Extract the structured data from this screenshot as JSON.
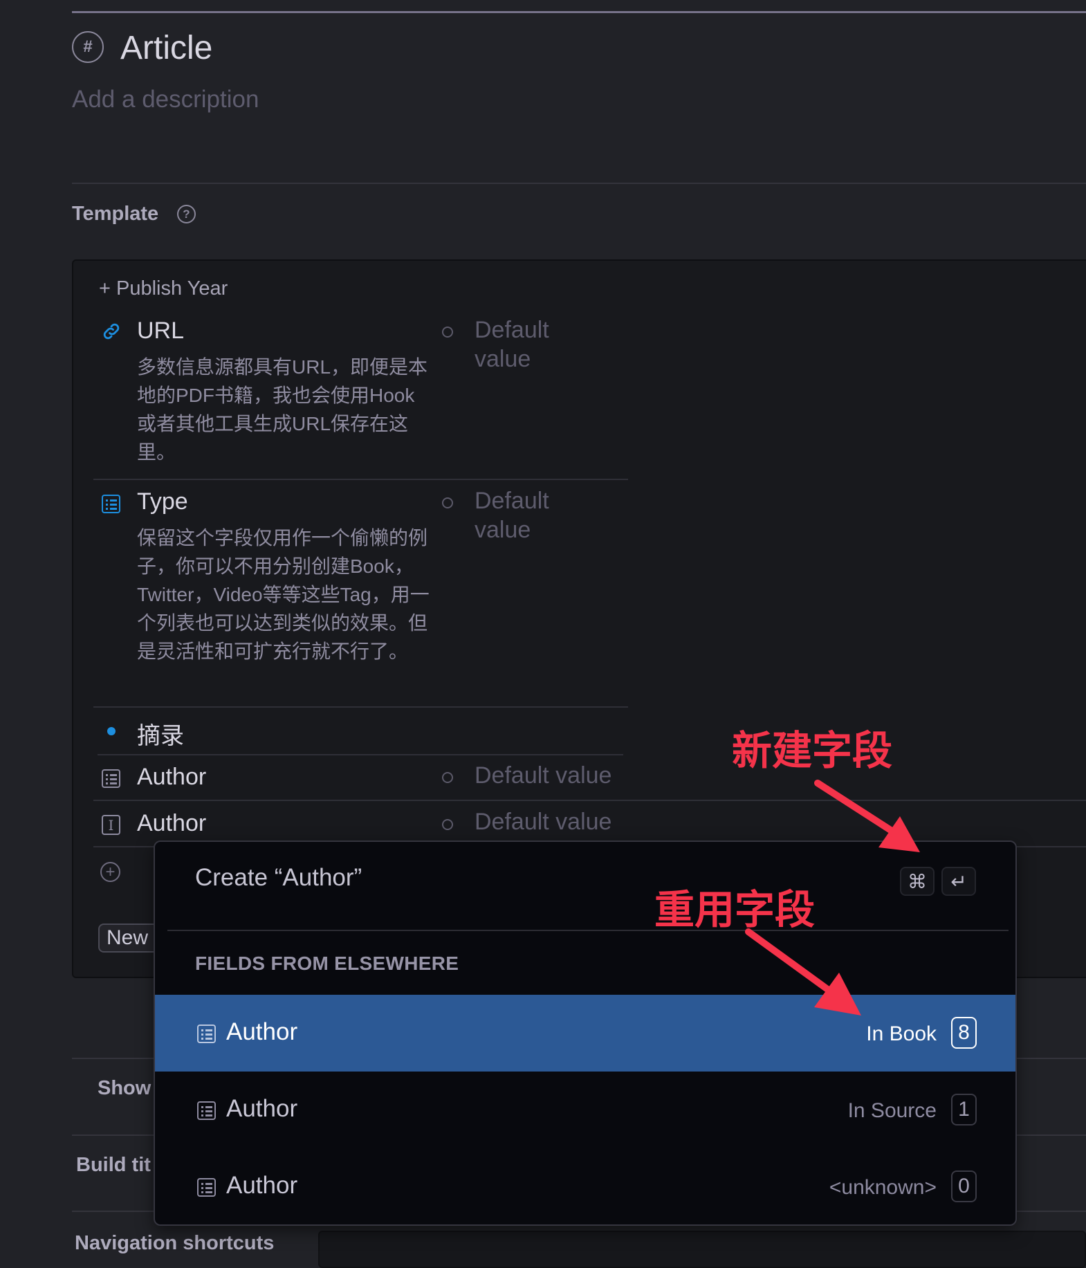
{
  "header": {
    "tag_icon": "hash-icon",
    "title": "Article",
    "description_placeholder": "Add a description"
  },
  "template": {
    "label": "Template",
    "help_icon": "question-circle-icon",
    "publish_year": {
      "icon": "plus-icon",
      "label": "Publish Year"
    },
    "fields": [
      {
        "icon": "link-icon",
        "name": "URL",
        "description": "多数信息源都具有URL，即便是本地的PDF书籍，我也会使用Hook或者其他工具生成URL保存在这里。",
        "default_placeholder": "Default value"
      },
      {
        "icon": "list-icon",
        "name": "Type",
        "description": "保留这个字段仅用作一个偷懒的例子，你可以不用分别创建Book，Twitter，Video等等这些Tag，用一个列表也可以达到类似的效果。但是灵活性和可扩充行就不行了。",
        "default_placeholder": "Default value"
      },
      {
        "icon": "dot-icon",
        "name": "摘录"
      },
      {
        "icon": "list-icon",
        "name": "Author",
        "default_placeholder": "Default value"
      },
      {
        "icon": "text-icon",
        "name": "Author",
        "default_placeholder": "Default value"
      }
    ],
    "add_field_icon": "plus-circle-icon",
    "new_button": "New"
  },
  "popup": {
    "create_label": "Create “Author”",
    "shortcut_keys": [
      "⌘",
      "↵"
    ],
    "section_label": "FIELDS FROM ELSEWHERE",
    "items": [
      {
        "icon": "list-icon",
        "name": "Author",
        "location": "In Book",
        "count": "8",
        "selected": true
      },
      {
        "icon": "list-icon",
        "name": "Author",
        "location": "In Source",
        "count": "1",
        "selected": false
      },
      {
        "icon": "list-icon",
        "name": "Author",
        "location": "<unknown>",
        "count": "0",
        "selected": false
      }
    ]
  },
  "settings": {
    "show_label": "Show",
    "build_title_label": "Build tit",
    "navigation_label": "Navigation shortcuts"
  },
  "annotations": {
    "new_field": "新建字段",
    "reuse_field": "重用字段",
    "color": "#f5334a"
  },
  "colors": {
    "accent_blue": "#1d8fe0",
    "selection": "#2c5995",
    "background": "#212227"
  }
}
